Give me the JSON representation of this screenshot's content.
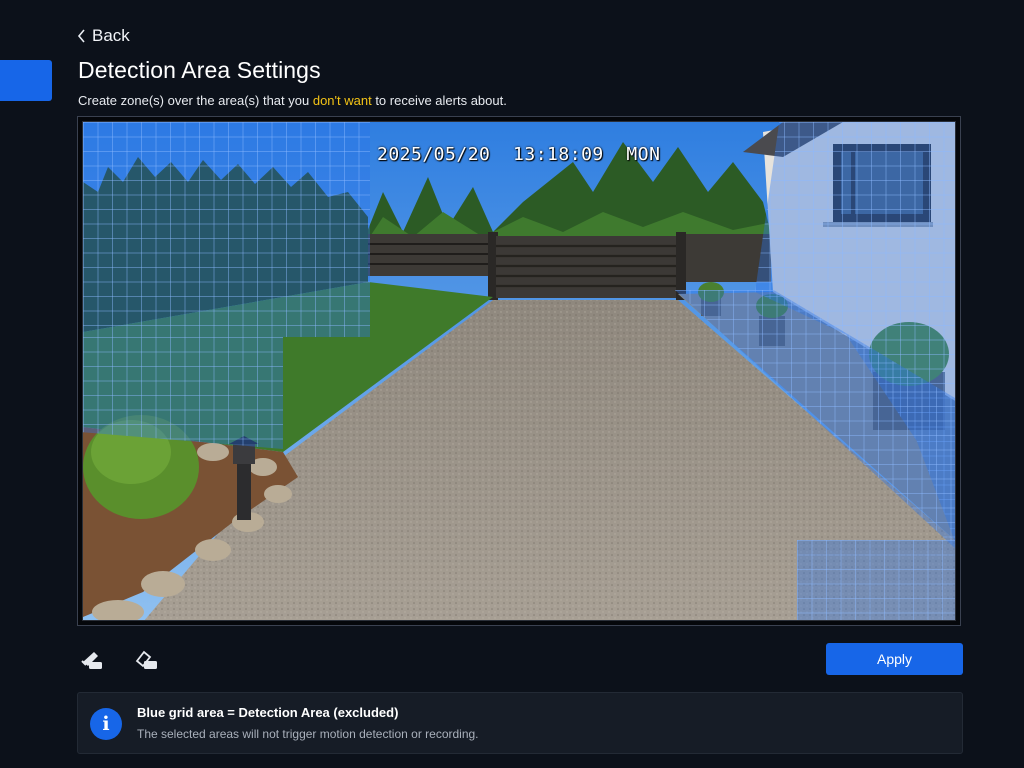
{
  "nav": {
    "back_label": "Back"
  },
  "page": {
    "title": "Detection Area Settings",
    "subtitle_pre": "Create zone(s) over the area(s) that you ",
    "subtitle_highlight": "don't want",
    "subtitle_post": " to receive alerts about."
  },
  "camera": {
    "timestamp": "2025/05/20  13:18:09  MON"
  },
  "toolbar": {
    "draw_tool_icon": "brush-draw-icon",
    "erase_tool_icon": "eraser-icon",
    "apply_label": "Apply"
  },
  "info": {
    "icon": "info-icon",
    "title": "Blue grid area = Detection Area (excluded)",
    "text": "The selected areas will not trigger motion detection or recording."
  },
  "colors": {
    "accent": "#1766e8",
    "highlight": "#f3c316",
    "zone": "#2b73eb"
  }
}
